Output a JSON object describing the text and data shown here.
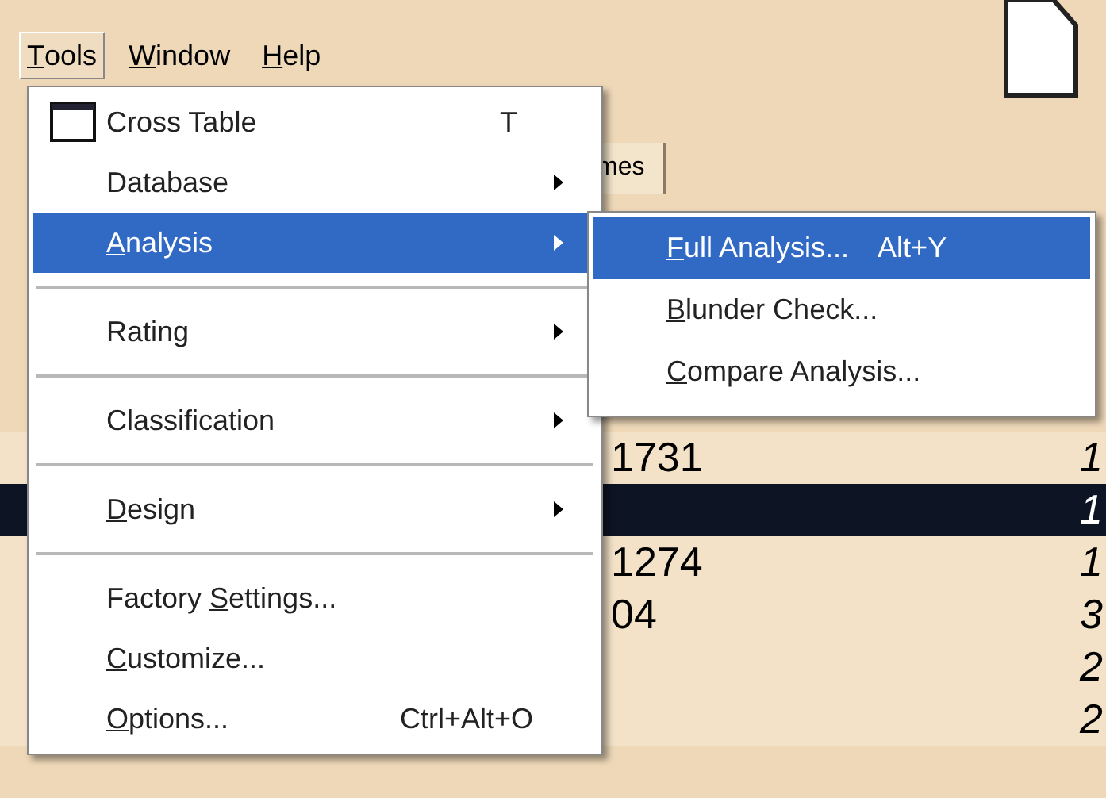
{
  "menubar": [
    {
      "label": {
        "key": "T",
        "after": "ools"
      },
      "selected": true
    },
    {
      "label": {
        "key": "W",
        "after": "indow"
      },
      "selected": false
    },
    {
      "label": {
        "key": "H",
        "after": "elp"
      },
      "selected": false
    }
  ],
  "background": {
    "tab": "mes",
    "rows": [
      {
        "cell": "1731",
        "end": "1",
        "selected": false
      },
      {
        "end": "1",
        "selected": true
      },
      {
        "cell": "1274",
        "end": "1",
        "selected": false
      },
      {
        "cell": "04",
        "end": "3",
        "selected": false
      },
      {
        "end": "2",
        "selected": false
      },
      {
        "end": "2",
        "selected": false
      }
    ]
  },
  "menu": [
    {
      "kind": "item",
      "label": {
        "after": "Cross Table"
      },
      "shortcut": "T",
      "icon": true,
      "submenu": false,
      "selected": false
    },
    {
      "kind": "item",
      "label": {
        "after": "Database"
      },
      "submenu": true,
      "selected": false
    },
    {
      "kind": "item",
      "label": {
        "key": "A",
        "after": "nalysis"
      },
      "submenu": true,
      "selected": true
    },
    {
      "kind": "separator"
    },
    {
      "kind": "item",
      "label": {
        "after": "Rating"
      },
      "submenu": true,
      "selected": false
    },
    {
      "kind": "separator"
    },
    {
      "kind": "item",
      "label": {
        "after": "Classification"
      },
      "submenu": true,
      "selected": false
    },
    {
      "kind": "separator"
    },
    {
      "kind": "item",
      "label": {
        "key": "D",
        "after": "esign"
      },
      "submenu": true,
      "selected": false
    },
    {
      "kind": "separator"
    },
    {
      "kind": "item",
      "label": {
        "before": "Factory ",
        "key": "S",
        "after": "ettings..."
      },
      "submenu": false,
      "selected": false
    },
    {
      "kind": "item",
      "label": {
        "key": "C",
        "after": "ustomize..."
      },
      "submenu": false,
      "selected": false
    },
    {
      "kind": "item",
      "label": {
        "key": "O",
        "after": "ptions..."
      },
      "shortcut": "Ctrl+Alt+O",
      "submenu": false,
      "selected": false
    }
  ],
  "submenu": [
    {
      "label": {
        "key": "F",
        "after": "ull Analysis..."
      },
      "shortcut": "Alt+Y",
      "selected": true
    },
    {
      "label": {
        "key": "B",
        "after": "lunder Check..."
      },
      "selected": false
    },
    {
      "label": {
        "key": "C",
        "after": "ompare Analysis..."
      },
      "selected": false
    }
  ]
}
